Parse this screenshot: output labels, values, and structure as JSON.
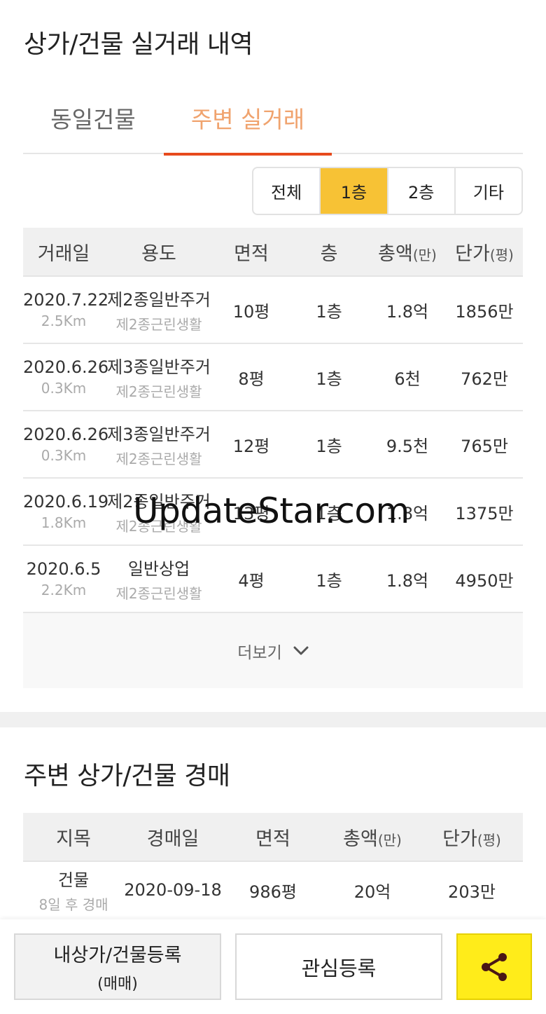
{
  "section1": {
    "title": "상가/건물 실거래 내역"
  },
  "tabs": [
    {
      "label": "동일건물"
    },
    {
      "label": "주변 실거래"
    }
  ],
  "floor_filter": [
    {
      "label": "전체"
    },
    {
      "label": "1층"
    },
    {
      "label": "2층"
    },
    {
      "label": "기타"
    }
  ],
  "trade_table": {
    "headers": {
      "date": "거래일",
      "use": "용도",
      "area": "면적",
      "floor": "층",
      "total": "총액",
      "total_unit": "(만)",
      "unit_price": "단가",
      "unit_price_unit": "(평)"
    },
    "rows": [
      {
        "date": "2020.7.22",
        "distance": "2.5Km",
        "zone": "제2종일반주거",
        "use": "제2종근린생활",
        "area": "10평",
        "floor": "1층",
        "total": "1.8억",
        "unit_price": "1856만"
      },
      {
        "date": "2020.6.26",
        "distance": "0.3Km",
        "zone": "제3종일반주거",
        "use": "제2종근린생활",
        "area": "8평",
        "floor": "1층",
        "total": "6천",
        "unit_price": "762만"
      },
      {
        "date": "2020.6.26",
        "distance": "0.3Km",
        "zone": "제3종일반주거",
        "use": "제2종근린생활",
        "area": "12평",
        "floor": "1층",
        "total": "9.5천",
        "unit_price": "765만"
      },
      {
        "date": "2020.6.19",
        "distance": "1.8Km",
        "zone": "제2종일반주거",
        "use": "제2종근린생활",
        "area": "13평",
        "floor": "1층",
        "total": "1.8억",
        "unit_price": "1375만"
      },
      {
        "date": "2020.6.5",
        "distance": "2.2Km",
        "zone": "일반상업",
        "use": "제2종근린생활",
        "area": "4평",
        "floor": "1층",
        "total": "1.8억",
        "unit_price": "4950만"
      }
    ]
  },
  "more_button": {
    "label": "더보기"
  },
  "section2": {
    "title": "주변 상가/건물 경매"
  },
  "auction_table": {
    "headers": {
      "land_type": "지목",
      "auction_date": "경매일",
      "area": "면적",
      "total": "총액",
      "total_unit": "(만)",
      "unit_price": "단가",
      "unit_price_unit": "(평)"
    },
    "rows": [
      {
        "land_type": "건물",
        "remaining": "8일 후 경매",
        "auction_date": "2020-09-18",
        "area": "986평",
        "total": "20억",
        "unit_price": "203만"
      }
    ]
  },
  "bottom_bar": {
    "register_label": "내상가/건물등록",
    "register_sub": "(매매)",
    "favorite_label": "관심등록"
  },
  "watermark": "UpdateStar.com",
  "colors": {
    "accent_tab": "#f0a36e",
    "tab_underline": "#e74a1d",
    "filter_active": "#f7c235",
    "share_button": "#ffec1a"
  }
}
